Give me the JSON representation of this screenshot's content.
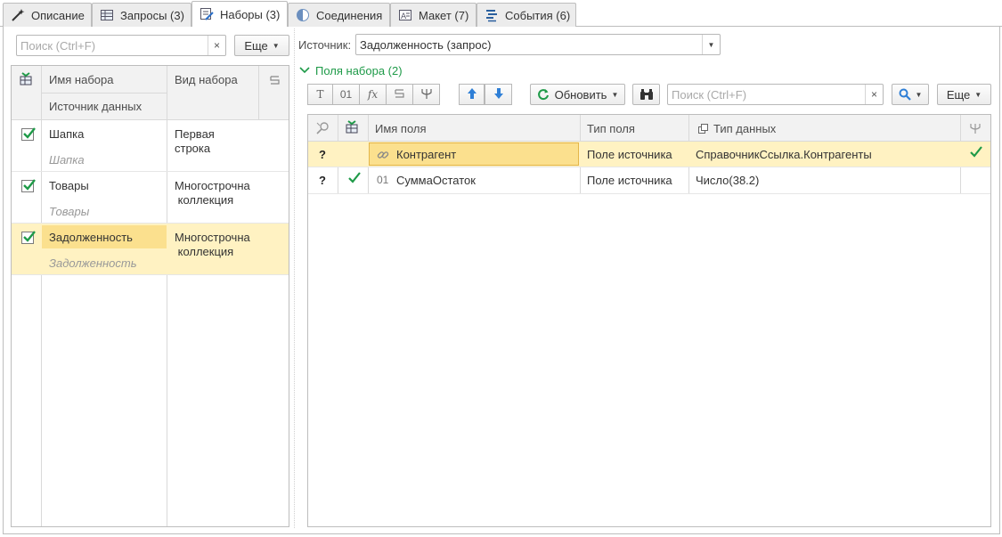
{
  "tabs": [
    {
      "label": "Описание",
      "icon": "wand-icon"
    },
    {
      "label": "Запросы (3)",
      "icon": "table-icon"
    },
    {
      "label": "Наборы (3)",
      "icon": "sets-icon"
    },
    {
      "label": "Соединения",
      "icon": "half-circle-icon"
    },
    {
      "label": "Макет (7)",
      "icon": "layout-icon"
    },
    {
      "label": "События (6)",
      "icon": "events-icon"
    }
  ],
  "active_tab": "Наборы (3)",
  "left": {
    "search_placeholder": "Поиск (Ctrl+F)",
    "clear": "×",
    "more_label": "Еще",
    "columns": {
      "name": "Имя набора",
      "source": "Источник данных",
      "kind": "Вид набора"
    },
    "rows": [
      {
        "name": "Шапка",
        "source": "Шапка",
        "kind_line1": "Первая",
        "kind_line2": "строка",
        "checked": true
      },
      {
        "name": "Товары",
        "source": "Товары",
        "kind_line1": "Многострочна",
        "kind_line2": " коллекция",
        "checked": true
      },
      {
        "name": "Задолженность",
        "source": "Задолженность",
        "kind_line1": "Многострочна",
        "kind_line2": " коллекция",
        "checked": true
      }
    ]
  },
  "right": {
    "source_label": "Источник:",
    "source_value": "Задолженность (запрос)",
    "fields_group": "Поля набора (2)",
    "refresh_label": "Обновить",
    "search_placeholder": "Поиск (Ctrl+F)",
    "clear": "×",
    "more_label": "Еще",
    "tool_t": "T",
    "tool_01": "01",
    "tool_fx": "fx",
    "columns": {
      "name": "Имя поля",
      "type": "Тип поля",
      "data_type": "Тип данных"
    },
    "rows": [
      {
        "q": "?",
        "type_prefix": "",
        "name": "Контрагент",
        "field_type": "Поле источника",
        "data_type": "СправочникСсылка.Контрагенты",
        "has_link": true
      },
      {
        "q": "?",
        "type_prefix": "01",
        "name": "СуммаОстаток",
        "field_type": "Поле источника",
        "data_type": "Число(38.2)",
        "has_link": false
      }
    ]
  },
  "colors": {
    "accent_green": "#1e9a48",
    "selection": "#fff2c2",
    "selection_cell": "#fbe08e",
    "border": "#bdbdbd"
  }
}
